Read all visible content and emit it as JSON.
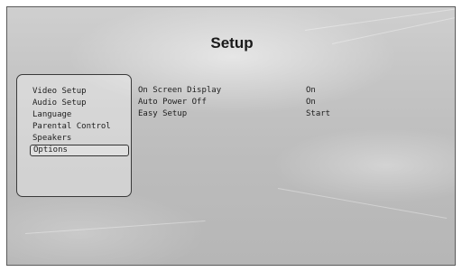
{
  "title": "Setup",
  "menu": {
    "items": [
      {
        "label": "Video Setup"
      },
      {
        "label": "Audio Setup"
      },
      {
        "label": "Language"
      },
      {
        "label": "Parental Control"
      },
      {
        "label": "Speakers"
      },
      {
        "label": "Options",
        "selected": true
      }
    ]
  },
  "settings": [
    {
      "name": "On Screen Display",
      "value": "On"
    },
    {
      "name": "Auto Power Off",
      "value": "On"
    },
    {
      "name": "Easy Setup",
      "value": "Start"
    }
  ]
}
